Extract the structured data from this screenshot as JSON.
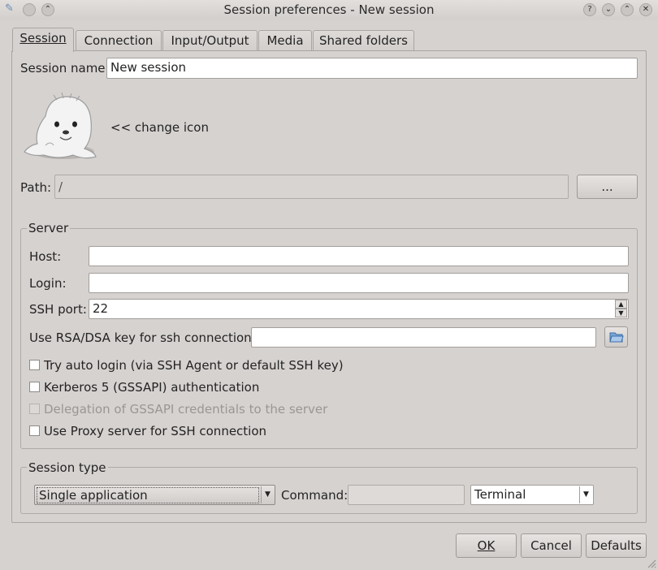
{
  "window": {
    "title": "Session preferences - New session"
  },
  "tabs": [
    {
      "label": "Session"
    },
    {
      "label": "Connection"
    },
    {
      "label": "Input/Output"
    },
    {
      "label": "Media"
    },
    {
      "label": "Shared folders"
    }
  ],
  "session": {
    "name_label": "Session name:",
    "name_value": "New session",
    "change_icon_label": "<< change icon",
    "path_label": "Path:",
    "path_value": "/",
    "path_browse_label": "..."
  },
  "server": {
    "group_label": "Server",
    "host_label": "Host:",
    "host_value": "",
    "login_label": "Login:",
    "login_value": "",
    "ssh_port_label": "SSH port:",
    "ssh_port_value": "22",
    "rsa_label": "Use RSA/DSA key for ssh connection:",
    "rsa_value": "",
    "options": [
      {
        "label": "Try auto login (via SSH Agent or default SSH key)",
        "checked": false,
        "enabled": true
      },
      {
        "label": "Kerberos 5 (GSSAPI) authentication",
        "checked": false,
        "enabled": true
      },
      {
        "label": "Delegation of GSSAPI credentials to the server",
        "checked": false,
        "enabled": false
      },
      {
        "label": "Use Proxy server for SSH connection",
        "checked": false,
        "enabled": true
      }
    ]
  },
  "session_type": {
    "group_label": "Session type",
    "type_value": "Single application",
    "command_label": "Command:",
    "command_value": "",
    "command_choice": "Terminal"
  },
  "buttons": {
    "ok": "OK",
    "cancel": "Cancel",
    "defaults": "Defaults"
  }
}
